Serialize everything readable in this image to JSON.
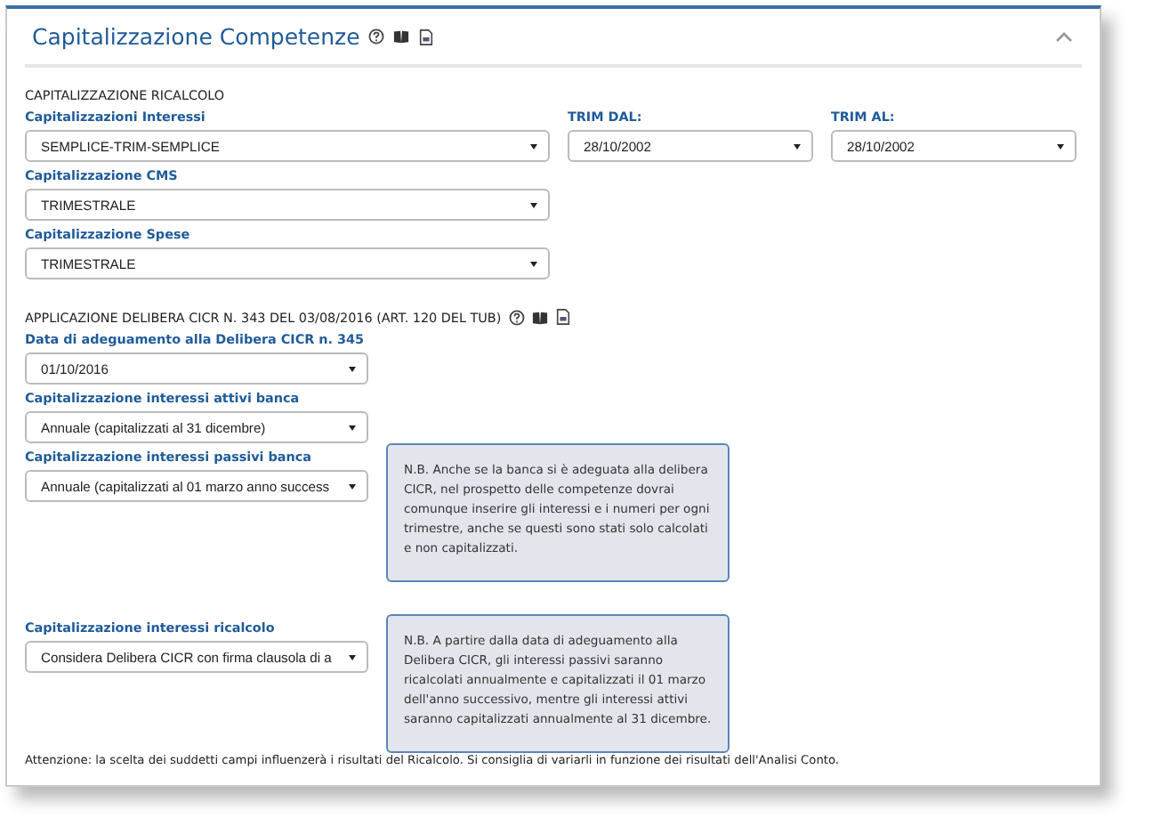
{
  "panel": {
    "title": "Capitalizzazione Competenze",
    "expanded": true
  },
  "ricalcolo": {
    "heading": "CAPITALIZZAZIONE RICALCOLO",
    "fields": [
      {
        "label": "Capitalizzazioni Interessi",
        "value": "SEMPLICE-TRIM-SEMPLICE"
      },
      {
        "label": "TRIM DAL:",
        "value": "28/10/2002"
      },
      {
        "label": "TRIM AL:",
        "value": "28/10/2002"
      },
      {
        "label": "Capitalizzazione CMS",
        "value": "TRIMESTRALE"
      },
      {
        "label": "Capitalizzazione Spese",
        "value": "TRIMESTRALE"
      }
    ]
  },
  "delibera": {
    "heading": "APPLICAZIONE DELIBERA CICR N. 343 DEL 03/08/2016 (ART. 120 DEL TUB)",
    "fields": [
      {
        "label": "Data di adeguamento alla Delibera CICR n. 345",
        "value": "01/10/2016"
      },
      {
        "label": "Capitalizzazione interessi attivi banca",
        "value": "Annuale (capitalizzati al 31 dicembre)"
      },
      {
        "label": "Capitalizzazione interessi passivi banca",
        "value": "Annuale (capitalizzati al 01 marzo anno success",
        "note": "N.B. Anche se la banca si è adeguata alla delibera CICR, nel prospetto delle competenze dovrai comunque inserire gli interessi e i numeri per ogni trimestre, anche se questi sono stati solo calcolati e non capitalizzati."
      },
      {
        "label": "Capitalizzazione interessi ricalcolo",
        "value": "Considera Delibera CICR con firma clausola di a",
        "note": "N.B. A partire dalla data di adeguamento alla Delibera CICR, gli interessi passivi saranno ricalcolati annualmente e capitalizzati il 01 marzo dell'anno successivo, mentre gli interessi attivi saranno capitalizzati annualmente al 31 dicembre."
      }
    ]
  },
  "footer": "Attenzione: la scelta dei suddetti campi influenzerà i risultati del Ricalcolo. Si consiglia di variarli in funzione dei risultati dell'Analisi Conto."
}
